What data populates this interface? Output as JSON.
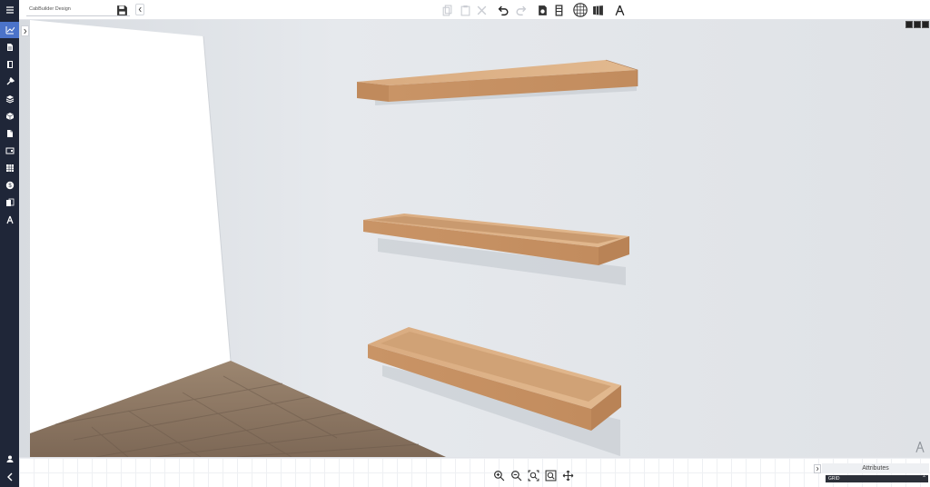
{
  "header": {
    "design_name": "CabBuilder Design"
  },
  "toolbar": {
    "tools": [
      {
        "icon": "copy-icon",
        "enabled": false
      },
      {
        "icon": "paste-icon",
        "enabled": false
      },
      {
        "icon": "delete-icon",
        "enabled": false
      },
      {
        "icon": "undo-icon",
        "enabled": true
      },
      {
        "icon": "redo-icon",
        "enabled": false
      },
      {
        "icon": "settings-doc-icon",
        "enabled": true
      },
      {
        "icon": "cabinet-icon",
        "enabled": true
      },
      {
        "icon": "grid-toggle-icon",
        "enabled": true
      },
      {
        "icon": "wall-view-icon",
        "enabled": true
      },
      {
        "icon": "compass-tool-icon",
        "enabled": true
      }
    ]
  },
  "sidebar": {
    "items": [
      {
        "icon": "menu-icon"
      },
      {
        "icon": "chart-icon",
        "active": true
      },
      {
        "icon": "document-icon"
      },
      {
        "icon": "panel-icon"
      },
      {
        "icon": "tools-icon"
      },
      {
        "icon": "layers-icon"
      },
      {
        "icon": "box-icon"
      },
      {
        "icon": "file-icon"
      },
      {
        "icon": "card-icon"
      },
      {
        "icon": "table-icon"
      },
      {
        "icon": "dollar-icon"
      },
      {
        "icon": "copy-docs-icon"
      },
      {
        "icon": "compass-icon"
      },
      {
        "icon": "user-icon"
      },
      {
        "icon": "back-icon"
      }
    ]
  },
  "viewport": {
    "shelf_count": 3,
    "wall_color": "#e4e7eb",
    "shelf_color": "#d3a276",
    "floor_color": "#8a7461"
  },
  "zoom_tools": [
    {
      "icon": "zoom-in-icon"
    },
    {
      "icon": "zoom-out-icon"
    },
    {
      "icon": "zoom-fit-icon"
    },
    {
      "icon": "zoom-selection-icon"
    },
    {
      "icon": "pan-icon"
    }
  ],
  "attributes": {
    "title": "Attributes",
    "selected": "GRID"
  }
}
